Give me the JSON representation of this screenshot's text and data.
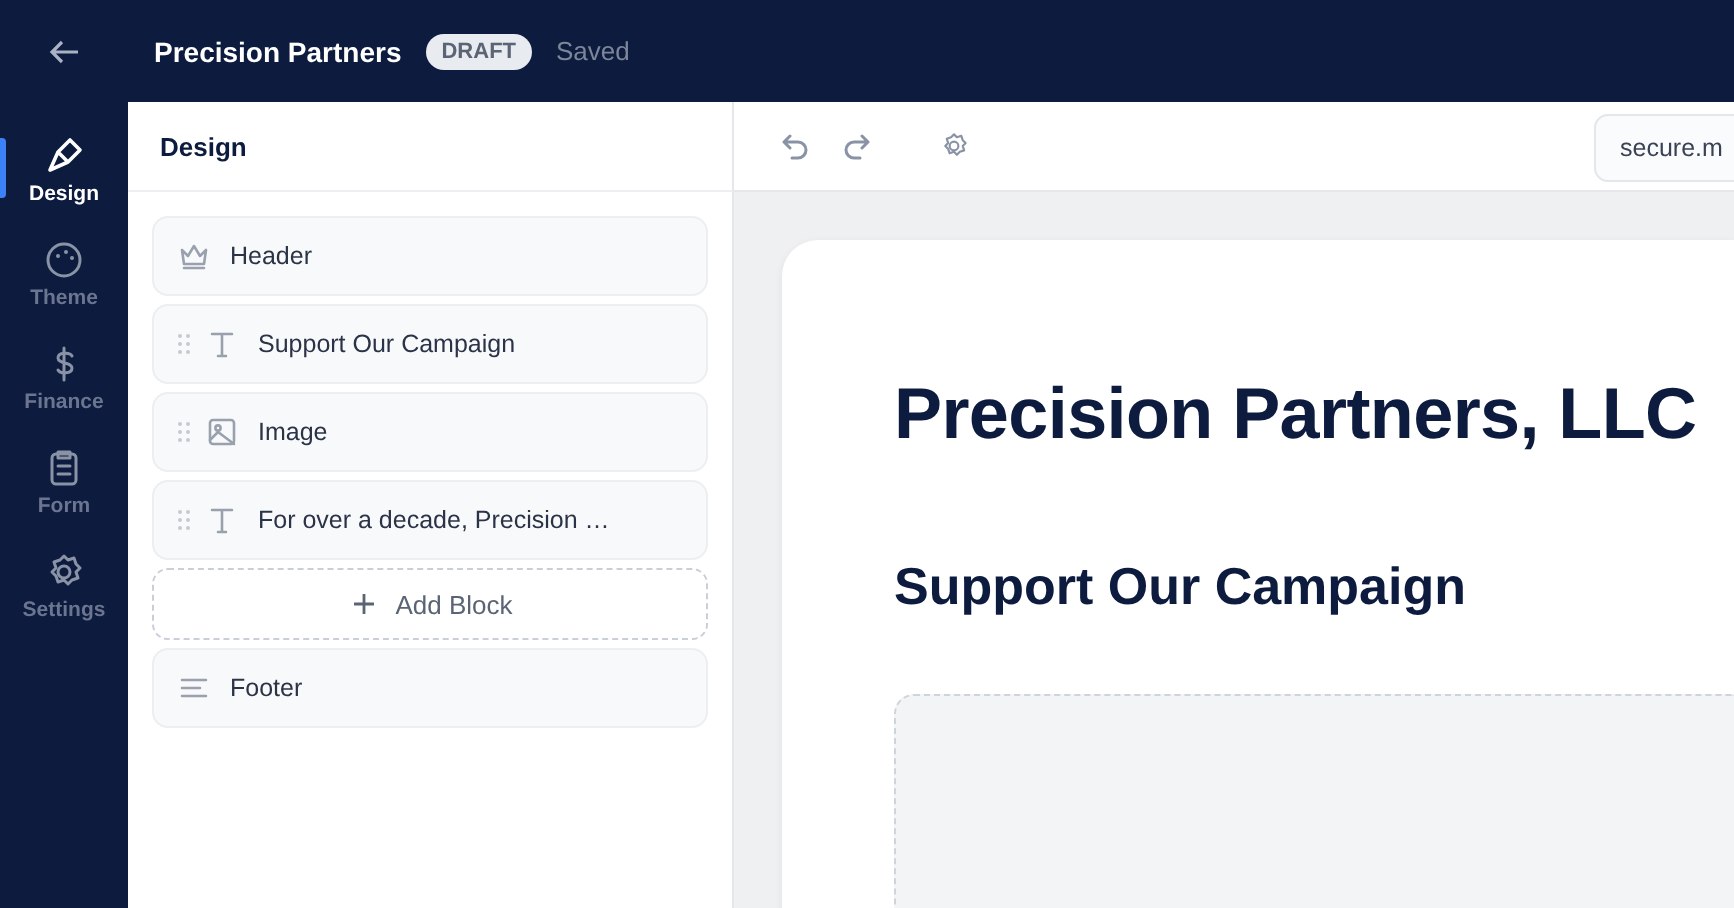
{
  "topbar": {
    "title": "Precision Partners",
    "badge": "DRAFT",
    "status": "Saved"
  },
  "nav": [
    {
      "kind": "brush",
      "label": "Design",
      "selected": true
    },
    {
      "kind": "palette",
      "label": "Theme",
      "selected": false
    },
    {
      "kind": "dollar",
      "label": "Finance",
      "selected": false
    },
    {
      "kind": "clipboard",
      "label": "Form",
      "selected": false
    },
    {
      "kind": "gear",
      "label": "Settings",
      "selected": false
    }
  ],
  "panel": {
    "title": "Design",
    "blocks": [
      {
        "kind": "header",
        "label": "Header",
        "draggable": false
      },
      {
        "kind": "text",
        "label": "Support Our Campaign",
        "draggable": true
      },
      {
        "kind": "image",
        "label": "Image",
        "draggable": true
      },
      {
        "kind": "text",
        "label": "For over a decade, Precision …",
        "draggable": true
      },
      {
        "kind": "add",
        "label": "Add Block",
        "draggable": false
      },
      {
        "kind": "footer",
        "label": "Footer",
        "draggable": false
      }
    ]
  },
  "toolbar": {
    "url": "secure.m"
  },
  "preview": {
    "title": "Precision Partners, LLC",
    "subtitle": "Support Our Campaign",
    "image": {
      "kind": "picture-placeholder"
    }
  }
}
